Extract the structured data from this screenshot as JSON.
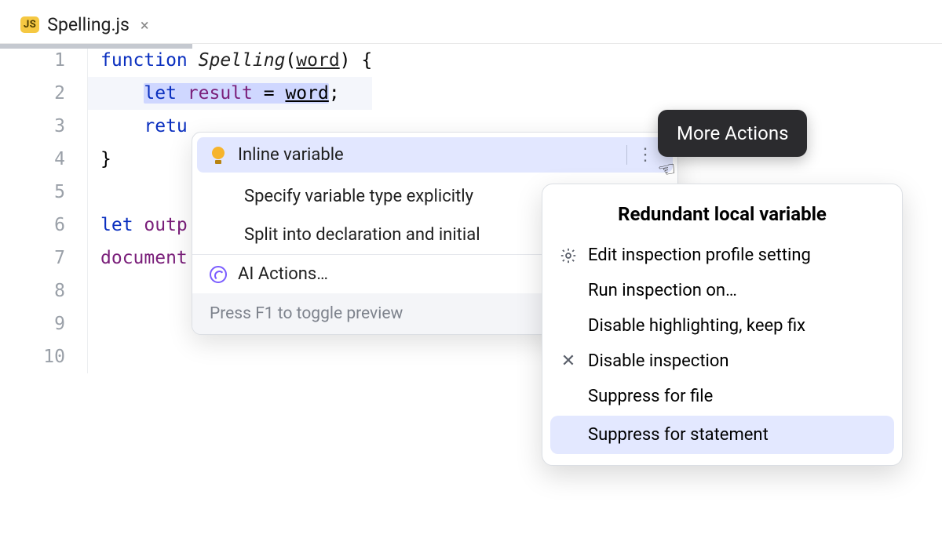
{
  "tab": {
    "icon_label": "JS",
    "filename": "Spelling.js"
  },
  "gutter": {
    "lines": [
      "1",
      "2",
      "3",
      "4",
      "5",
      "6",
      "7",
      "8",
      "9",
      "10"
    ]
  },
  "code": {
    "l1_kw": "function",
    "l1_fn": "Spelling",
    "l1_paren_open": "(",
    "l1_param": "word",
    "l1_rest": ") {",
    "l2_let": "let",
    "l2_var": "result",
    "l2_eq": " = ",
    "l2_rhs": "word",
    "l2_semi": ";",
    "l3_return": "retu",
    "l4_brace": "}",
    "l6_let": "let",
    "l6_rest": " outp",
    "l7": "document"
  },
  "popup1": {
    "item1": "Inline variable",
    "item2": "Specify variable type explicitly",
    "item3": "Split into declaration and initial",
    "item4": "AI Actions…",
    "footer": "Press F1 to toggle preview"
  },
  "tooltip": {
    "text": "More Actions"
  },
  "popup2": {
    "title": "Redundant local variable",
    "item1": "Edit inspection profile setting",
    "item2": "Run inspection on…",
    "item3": "Disable highlighting, keep fix",
    "item4": "Disable inspection",
    "item5": "Suppress for file",
    "item6": "Suppress for statement"
  }
}
